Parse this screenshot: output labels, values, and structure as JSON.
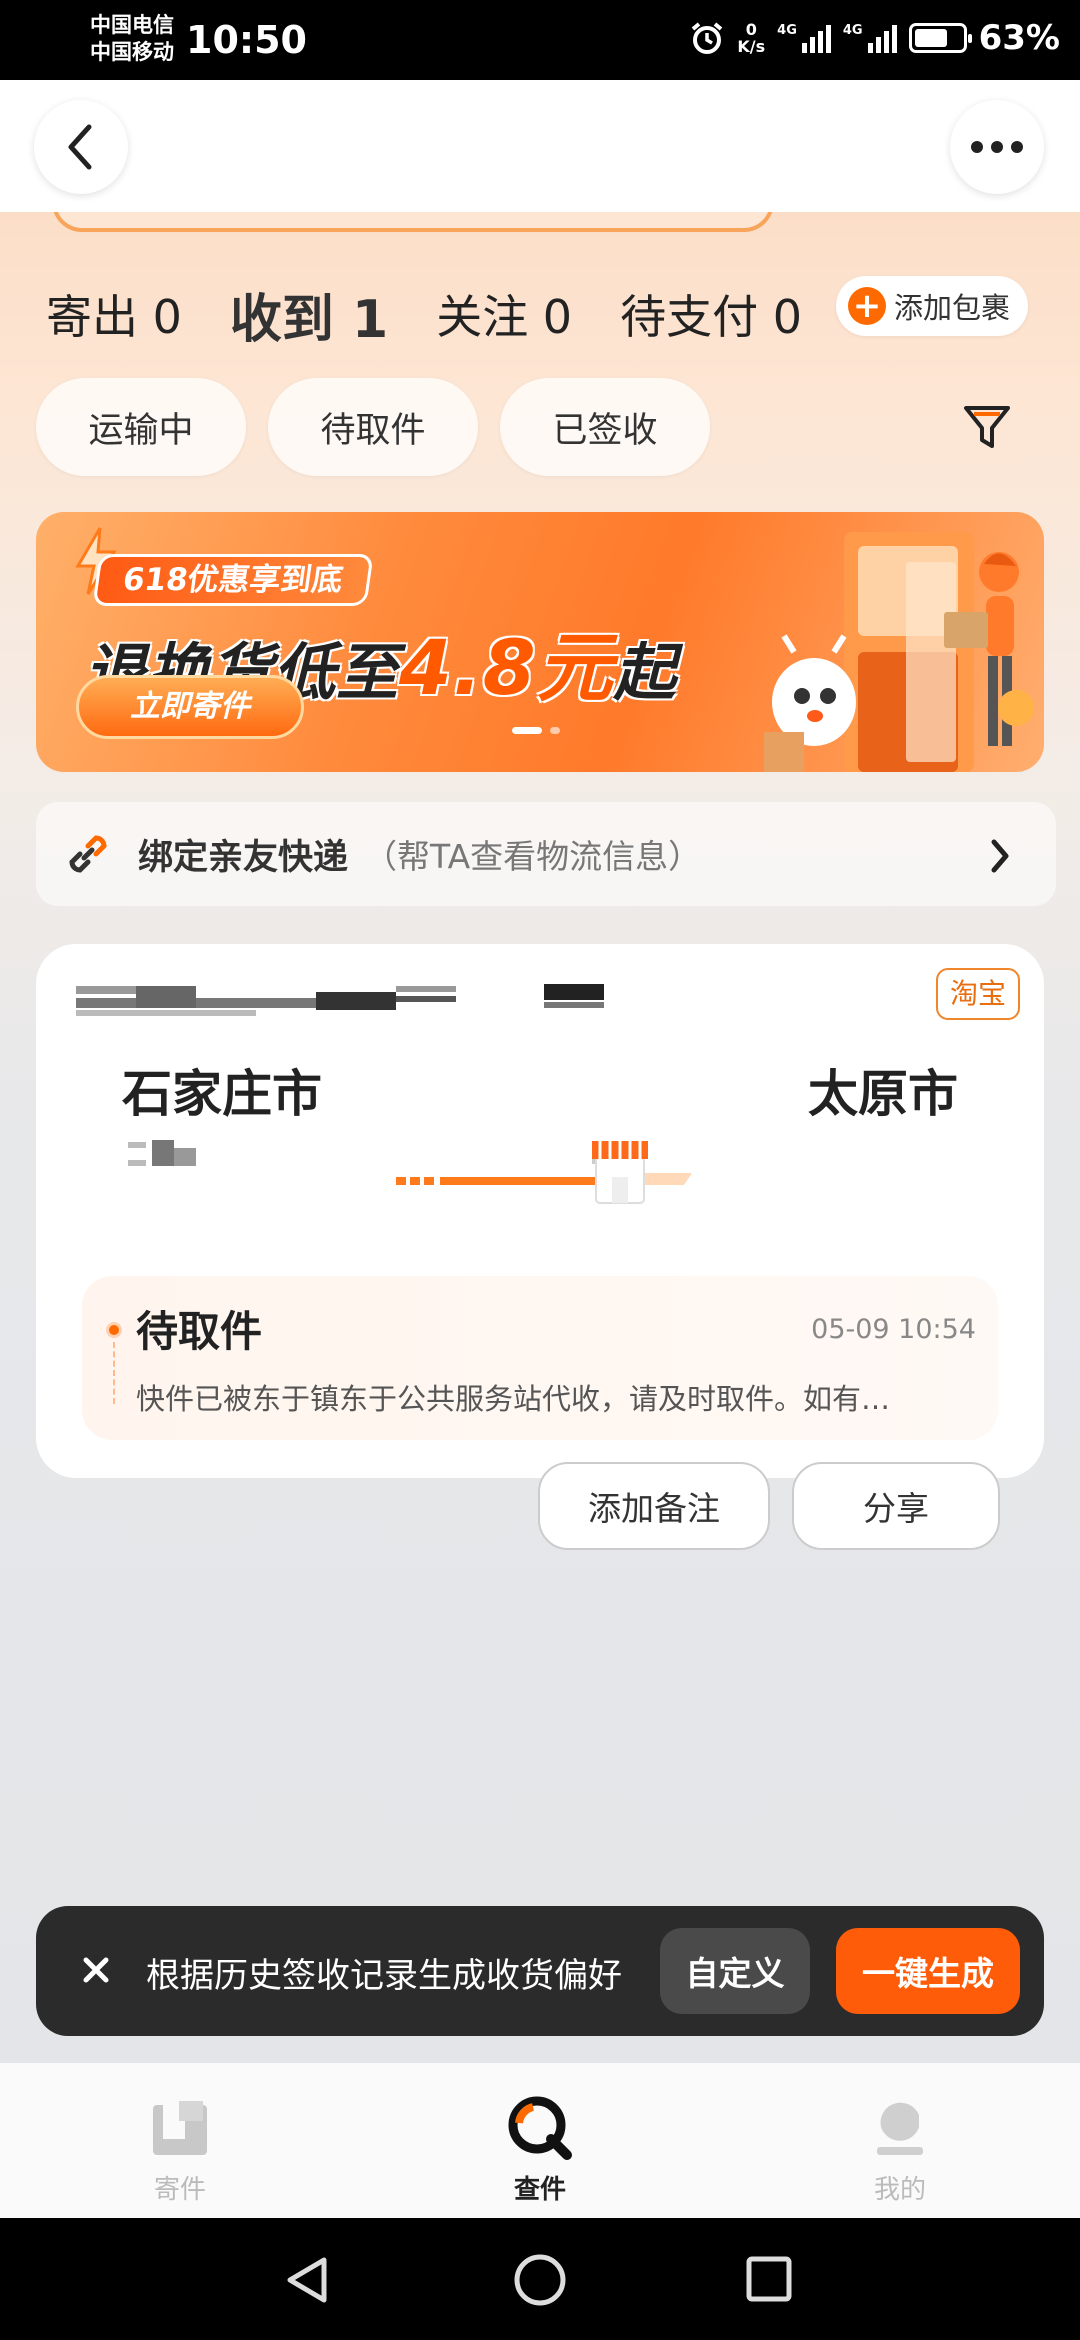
{
  "status_bar": {
    "carrier1": "中国电信",
    "carrier2": "中国移动",
    "time": "10:50",
    "net_speed_value": "0",
    "net_speed_unit": "K/s",
    "network_type": "4G",
    "battery": "63%",
    "icons": [
      "alarm-icon",
      "signal-icon",
      "battery-icon"
    ]
  },
  "header": {
    "back_icon": "chevron-left-icon",
    "more_icon": "more-dots-icon"
  },
  "tabs": [
    {
      "label": "寄出 0",
      "active": false
    },
    {
      "label": "收到 1",
      "active": true
    },
    {
      "label": "关注 0",
      "active": false
    },
    {
      "label": "待支付 0",
      "active": false
    }
  ],
  "add_package": {
    "label": "添加包裹",
    "icon": "plus-circle-icon"
  },
  "filters": [
    {
      "label": "运输中"
    },
    {
      "label": "待取件"
    },
    {
      "label": "已签收"
    }
  ],
  "filter_icon": "funnel-icon",
  "banner": {
    "tag": "618优惠享到底",
    "headline_prefix": "退换货低至",
    "headline_highlight": "4.8元",
    "headline_suffix": "起",
    "cta": "立即寄件",
    "page": 1,
    "page_count": 2
  },
  "bind_row": {
    "title": "绑定亲友快递",
    "subtitle": "（帮TA查看物流信息）",
    "icon": "link-icon"
  },
  "package": {
    "source": "淘宝",
    "from_city": "石家庄市",
    "to_city": "太原市",
    "status": "待取件",
    "time": "05-09 10:54",
    "description": "快件已被东于镇东于公共服务站代收，请及时取件。如有…",
    "actions": [
      "添加备注",
      "分享"
    ]
  },
  "toast": {
    "text": "根据历史签收记录生成收货偏好",
    "custom_label": "自定义",
    "generate_label": "一键生成"
  },
  "bottom_nav": [
    {
      "label": "寄件",
      "icon": "send-box-icon",
      "active": false
    },
    {
      "label": "查件",
      "icon": "search-q-icon",
      "active": true
    },
    {
      "label": "我的",
      "icon": "profile-icon",
      "active": false
    }
  ],
  "colors": {
    "accent": "#ff6a00",
    "tag_border": "#f0852a",
    "toast_bg": "#2b2b2b",
    "generate_bg": "#ff5c0a"
  }
}
